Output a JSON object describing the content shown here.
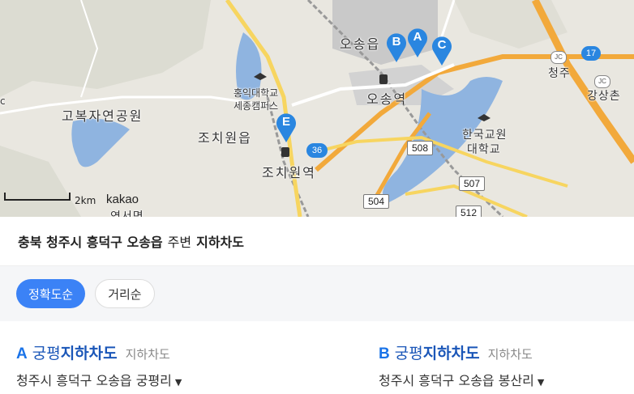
{
  "map": {
    "labels": {
      "osong_eup": "오송읍",
      "cheongju": "청주",
      "gangsangchon": "강상촌",
      "hongik_univ": "홍익대학교",
      "sejong_campus": "세종캠퍼스",
      "gobok_park": "고복자연공원",
      "jochiwon_eup": "조치원읍",
      "osong_station": "오송역",
      "knue_1": "한국교원",
      "knue_2": "대학교",
      "jochiwon_station": "조치원역",
      "yeonseo": "연서면",
      "left_c": "c"
    },
    "routes": {
      "r36": "36",
      "r508": "508",
      "r507": "507",
      "r504": "504",
      "r512": "512",
      "r17": "17",
      "jc1": "JC",
      "jc2": "JC"
    },
    "markers": {
      "a": "A",
      "b": "B",
      "c": "C",
      "e": "E"
    },
    "scale_label": "2km",
    "brand": "kakao",
    "colors": {
      "marker": "#2a86e0",
      "highway": "#f2a93b",
      "road": "#f7d560",
      "water": "#8fb4e0"
    }
  },
  "header": {
    "region": "충북 청주시 흥덕구 오송읍",
    "middle": "주변",
    "keyword": "지하차도"
  },
  "sort": {
    "accuracy": "정확도순",
    "distance": "거리순"
  },
  "results": [
    {
      "letter": "A",
      "name_prefix": "궁평",
      "name_highlight": "지하차도",
      "category": "지하차도",
      "address": "청주시 흥덕구 오송읍 궁평리"
    },
    {
      "letter": "B",
      "name_prefix": "궁평",
      "name_highlight": "지하차도",
      "category": "지하차도",
      "address": "청주시 흥덕구 오송읍 봉산리"
    }
  ]
}
